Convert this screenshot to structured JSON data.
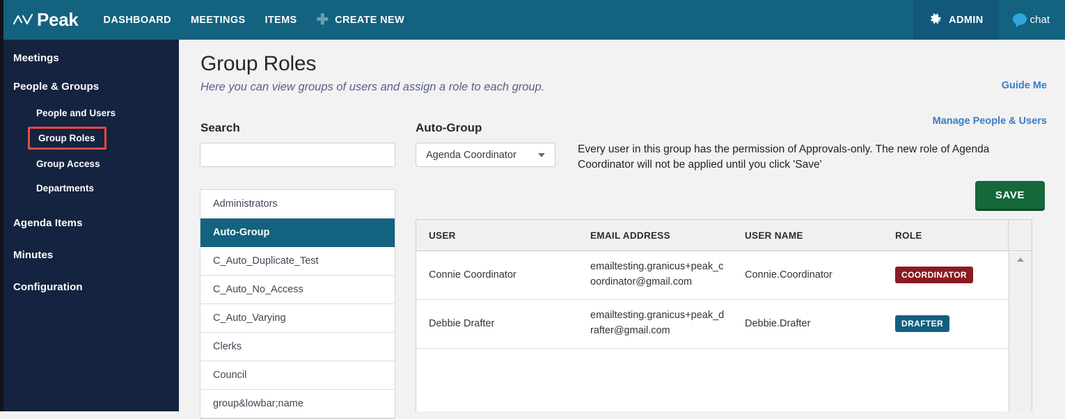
{
  "topbar": {
    "logo_text": "Peak",
    "logo_icon": "zigzag-chart-icon",
    "nav": [
      {
        "label": "DASHBOARD"
      },
      {
        "label": "MEETINGS"
      },
      {
        "label": "ITEMS"
      }
    ],
    "create_new": {
      "icon": "plus-icon",
      "label": "CREATE NEW"
    },
    "admin": {
      "icon": "gear-icon",
      "label": "ADMIN"
    },
    "chat": {
      "icon": "chat-bubble-icon",
      "label": "chat"
    }
  },
  "sidebar": {
    "items": [
      {
        "label": "Meetings",
        "level": "top"
      },
      {
        "label": "People & Groups",
        "level": "top"
      },
      {
        "label": "People and Users",
        "level": "sub"
      },
      {
        "label": "Group Roles",
        "level": "sub",
        "highlighted": true
      },
      {
        "label": "Group Access",
        "level": "sub"
      },
      {
        "label": "Departments",
        "level": "sub"
      },
      {
        "label": "Agenda Items",
        "level": "top"
      },
      {
        "label": "Minutes",
        "level": "top"
      },
      {
        "label": "Configuration",
        "level": "top"
      }
    ]
  },
  "main": {
    "title": "Group Roles",
    "subtitle": "Here you can view groups of users and assign a role to each group.",
    "guide_me": "Guide Me",
    "manage_link": "Manage People & Users",
    "search": {
      "label": "Search",
      "value": "",
      "placeholder": ""
    },
    "autogroup": {
      "label": "Auto-Group",
      "selected": "Agenda Coordinator",
      "caret_icon": "chevron-down-icon"
    },
    "permission_note": "Every user in this group has the permission of Approvals-only. The new role of Agenda Coordinator will not be applied until you click 'Save'",
    "save_label": "SAVE",
    "group_list": [
      {
        "label": "Administrators",
        "selected": false
      },
      {
        "label": "Auto-Group",
        "selected": true
      },
      {
        "label": "C_Auto_Duplicate_Test",
        "selected": false
      },
      {
        "label": "C_Auto_No_Access",
        "selected": false
      },
      {
        "label": "C_Auto_Varying",
        "selected": false
      },
      {
        "label": "Clerks",
        "selected": false
      },
      {
        "label": "Council",
        "selected": false
      },
      {
        "label": "group&lowbar;name",
        "selected": false
      }
    ],
    "table": {
      "columns": [
        "USER",
        "EMAIL ADDRESS",
        "USER NAME",
        "ROLE"
      ],
      "rows": [
        {
          "user": "Connie Coordinator",
          "email": "emailtesting.granicus+peak_coordinator@gmail.com",
          "username": "Connie.Coordinator",
          "role": "COORDINATOR",
          "role_color": "#8b1a21"
        },
        {
          "user": "Debbie Drafter",
          "email": "emailtesting.granicus+peak_drafter@gmail.com",
          "username": "Debbie.Drafter",
          "role": "DRAFTER",
          "role_color": "#135f80"
        }
      ],
      "scroll_up_icon": "scroll-up-arrow-icon"
    }
  },
  "colors": {
    "header_teal": "#13627f",
    "admin_block": "#11587a",
    "sidebar_navy": "#14233f",
    "highlight_red": "#f2483f",
    "link_blue": "#3b7dc4",
    "save_green": "#15683a",
    "page_bg": "#f2f2f2"
  }
}
